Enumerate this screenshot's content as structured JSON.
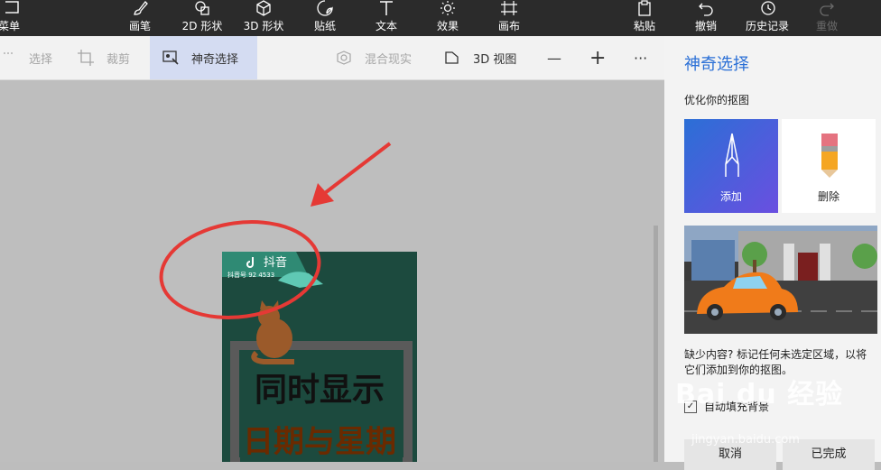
{
  "toolbar": {
    "menu": "菜单",
    "brushes": "画笔",
    "shapes2d": "2D 形状",
    "shapes3d": "3D 形状",
    "stickers": "贴纸",
    "text": "文本",
    "effects": "效果",
    "canvas": "画布",
    "paste": "粘贴",
    "undo": "撤销",
    "history": "历史记录",
    "redo": "重做"
  },
  "subtoolbar": {
    "select": "选择",
    "crop": "裁剪",
    "magic_select": "神奇选择",
    "mixed_reality": "混合现实",
    "view3d": "3D 视图",
    "zoom_out": "—",
    "zoom_in": "+",
    "more": "···"
  },
  "panel": {
    "title": "神奇选择",
    "subtitle": "优化你的抠图",
    "add": "添加",
    "remove": "删除",
    "hint": "缺少内容? 标记任何未选定区域，以将它们添加到你的抠图。",
    "autofill": "自动填充背景",
    "cancel": "取消",
    "done": "已完成"
  },
  "artwork": {
    "app_name": "抖音",
    "account": "抖音号 92   4533",
    "line1": "同时显示",
    "line2": "日期与星期"
  },
  "watermark": {
    "brand": "Bai du 经验",
    "url": "jingyan.baidu.com"
  },
  "colors": {
    "accent": "#2a6fd6",
    "annotation": "#e53935",
    "artwork_bg": "#1c4a3e"
  }
}
